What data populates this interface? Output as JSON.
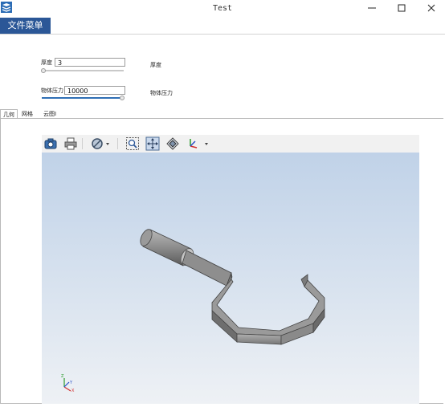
{
  "window": {
    "title": "Test"
  },
  "menu": {
    "file_label": "文件菜单"
  },
  "params": {
    "thickness": {
      "label": "厚度",
      "value": "3",
      "right_label": "厚度",
      "slider": 0.0
    },
    "pressure": {
      "label": "物体压力",
      "value": "10000",
      "right_label": "物体压力",
      "slider": 1.0
    }
  },
  "tabs": [
    {
      "label": "几何",
      "active": true
    },
    {
      "label": "网格",
      "active": false
    },
    {
      "label": "云图I",
      "active": false
    }
  ],
  "toolbar": {
    "icons": [
      "camera-icon",
      "printer-icon",
      "clip-plane-icon",
      "zoom-box-icon",
      "fit-all-icon",
      "view-cube-icon",
      "axis-triad-icon"
    ]
  },
  "axis_labels": {
    "x": "X",
    "y": "Y",
    "z": "Z"
  },
  "colors": {
    "accent": "#2b5797",
    "viewport_top": "#c0d2e8",
    "part": "#8a8a8a"
  }
}
